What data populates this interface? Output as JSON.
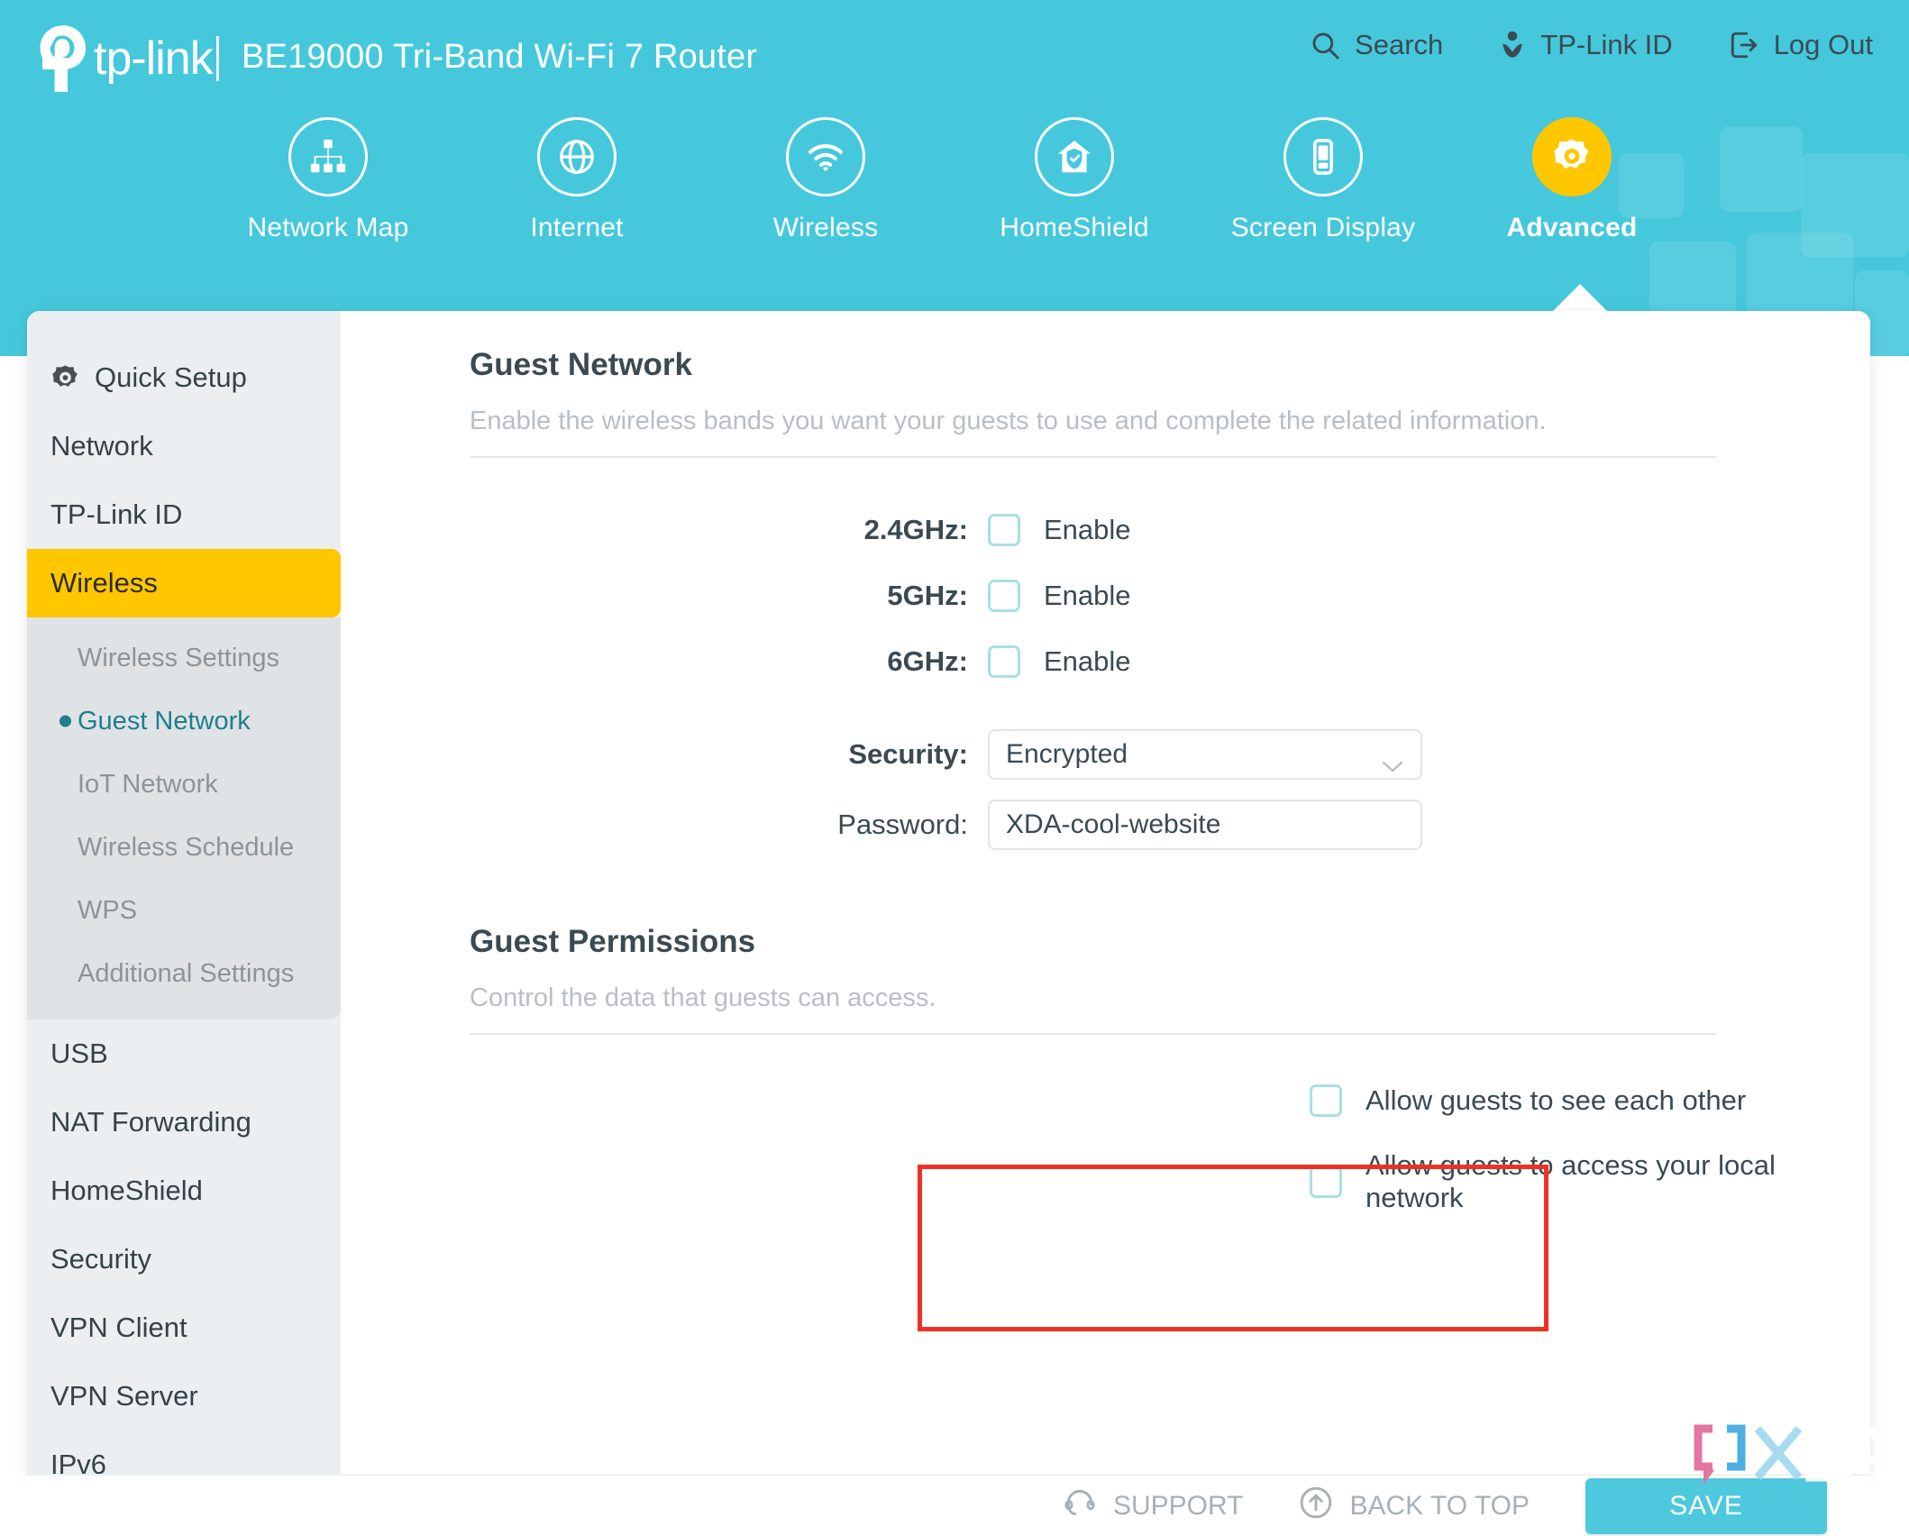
{
  "header": {
    "brand": "tp-link",
    "separator": "|",
    "model": "BE19000 Tri-Band Wi-Fi 7 Router",
    "actions": [
      {
        "label": "Search",
        "icon": "search-icon"
      },
      {
        "label": "TP-Link ID",
        "icon": "user-icon"
      },
      {
        "label": "Log Out",
        "icon": "logout-icon"
      }
    ],
    "accent_teal": "#45c8dc",
    "accent_yellow": "#ffc700"
  },
  "nav": {
    "tabs": [
      {
        "label": "Network Map",
        "icon": "network-map-icon",
        "active": false
      },
      {
        "label": "Internet",
        "icon": "globe-icon",
        "active": false
      },
      {
        "label": "Wireless",
        "icon": "wifi-icon",
        "active": false
      },
      {
        "label": "HomeShield",
        "icon": "home-shield-icon",
        "active": false
      },
      {
        "label": "Screen Display",
        "icon": "screen-display-icon",
        "active": false
      },
      {
        "label": "Advanced",
        "icon": "gear-icon",
        "active": true
      }
    ]
  },
  "sidebar": {
    "items": [
      {
        "label": "Quick Setup",
        "icon": "gear-icon"
      },
      {
        "label": "Network"
      },
      {
        "label": "TP-Link ID"
      },
      {
        "label": "Wireless",
        "active": true
      }
    ],
    "submenu": [
      {
        "label": "Wireless Settings",
        "current": false
      },
      {
        "label": "Guest Network",
        "current": true
      },
      {
        "label": "IoT Network",
        "current": false
      },
      {
        "label": "Wireless Schedule",
        "current": false
      },
      {
        "label": "WPS",
        "current": false
      },
      {
        "label": "Additional Settings",
        "current": false
      }
    ],
    "items_after": [
      {
        "label": "USB"
      },
      {
        "label": "NAT Forwarding"
      },
      {
        "label": "HomeShield"
      },
      {
        "label": "Security"
      },
      {
        "label": "VPN Client"
      },
      {
        "label": "VPN Server"
      },
      {
        "label": "IPv6"
      }
    ]
  },
  "main": {
    "guest_network": {
      "title": "Guest Network",
      "description": "Enable the wireless bands you want your guests to use and complete the related information.",
      "bands": [
        {
          "label": "2.4GHz:",
          "checkbox_label": "Enable",
          "checked": false
        },
        {
          "label": "5GHz:",
          "checkbox_label": "Enable",
          "checked": false
        },
        {
          "label": "6GHz:",
          "checkbox_label": "Enable",
          "checked": false
        }
      ],
      "security": {
        "label": "Security:",
        "value": "Encrypted",
        "icon": "chevron-down-icon"
      },
      "password": {
        "label": "Password:",
        "value": "XDA-cool-website"
      }
    },
    "guest_permissions": {
      "title": "Guest Permissions",
      "description": "Control the data that guests can access.",
      "highlight_color": "#ef3124",
      "options": [
        {
          "label": "Allow guests to see each other",
          "checked": false
        },
        {
          "label": "Allow guests to access your local network",
          "checked": false
        }
      ]
    }
  },
  "footer": {
    "support": {
      "label": "SUPPORT",
      "icon": "headset-icon"
    },
    "back_to_top": {
      "label": "BACK TO TOP",
      "icon": "arrow-up-circle-icon"
    },
    "save": "SAVE"
  },
  "watermark": {
    "text": "XDA"
  }
}
